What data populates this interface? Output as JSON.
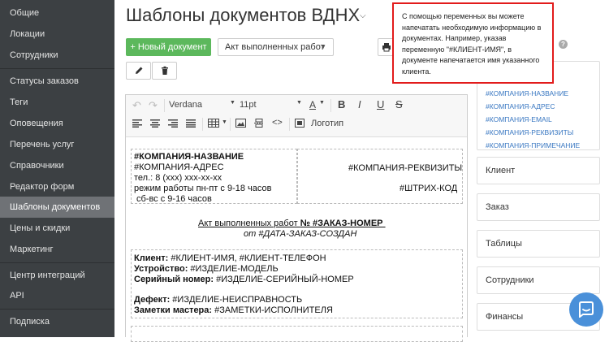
{
  "sidebar": {
    "items": [
      {
        "label": "Общие",
        "active": false
      },
      {
        "label": "Локации",
        "active": false
      },
      {
        "label": "Сотрудники",
        "active": false
      },
      {
        "label": "Статусы заказов",
        "active": false
      },
      {
        "label": "Теги",
        "active": false
      },
      {
        "label": "Оповещения",
        "active": false
      },
      {
        "label": "Перечень услуг",
        "active": false
      },
      {
        "label": "Справочники",
        "active": false
      },
      {
        "label": "Редактор форм",
        "active": false
      },
      {
        "label": "Шаблоны документов",
        "active": true
      },
      {
        "label": "Цены и скидки",
        "active": false
      },
      {
        "label": "Маркетинг",
        "active": false
      },
      {
        "label": "Центр интеграций",
        "active": false
      },
      {
        "label": "API",
        "active": false
      },
      {
        "label": "Подписка",
        "active": false
      }
    ]
  },
  "header": {
    "title": "Шаблоны документов ВДНХ",
    "new_doc_label": "+ Новый документ",
    "doc_select_value": "Акт выполненных работ"
  },
  "toolbar": {
    "font_family": "Verdana",
    "font_size": "11pt",
    "font_color_label": "A",
    "bold_label": "B",
    "italic_label": "I",
    "underline_label": "U",
    "strike_label": "S",
    "code_label": "<>",
    "logo_label": "Логотип"
  },
  "document": {
    "company_name": "#КОМПАНИЯ-НАЗВАНИЕ",
    "company_address": "#КОМПАНИЯ-АДРЕС",
    "phone": "тел.: 8 (xxx) xxx-xx-xx",
    "hours_weekday": "режим работы  пн-пт с 9-18 часов",
    "hours_weekend": "сб-вс с 9-16 часов",
    "company_requisites": "#КОМПАНИЯ-РЕКВИЗИТЫ",
    "barcode": "#ШТРИХ-КОД",
    "act_title_prefix": "Акт выполненных работ ",
    "act_title_number": "№ #ЗАКАЗ-НОМЕР",
    "act_date": "от #ДАТА-ЗАКАЗ-СОЗДАН",
    "client_label": "Клиент:",
    "client_value": " #КЛИЕНТ-ИМЯ, #КЛИЕНТ-ТЕЛЕФОН",
    "device_label": "Устройство:",
    "device_value": " #ИЗДЕЛИЕ-МОДЕЛЬ",
    "serial_label": "Серийный номер:",
    "serial_value": " #ИЗДЕЛИЕ-СЕРИЙНЫЙ-НОМЕР",
    "defect_label": "Дефект:",
    "defect_value": " #ИЗДЕЛИЕ-НЕИСПРАВНОСТЬ",
    "notes_label": "Заметки мастера:",
    "notes_value": " #ЗАМЕТКИ-ИСПОЛНИТЕЛЯ"
  },
  "variables": [
    "#КОМПАНИЯ-НАЗВАНИЕ",
    "#КОМПАНИЯ-АДРЕС",
    "#КОМПАНИЯ-EMAIL",
    "#КОМПАНИЯ-РЕКВИЗИТЫ",
    "#КОМПАНИЯ-ПРИМЕЧАНИЕ"
  ],
  "sections": [
    "Клиент",
    "Заказ",
    "Таблицы",
    "Сотрудники",
    "Финансы"
  ],
  "tooltip": {
    "text": "С помощью переменных вы можете напечатать необходимую информацию в документах. Например, указав переменную \"#КЛИЕНТ-ИМЯ\", в документе напечатается имя указанного клиента."
  },
  "colors": {
    "sidebar_bg": "#3c4043",
    "sidebar_active": "#6f7276",
    "primary_button": "#5cb85c",
    "link": "#3a78c2",
    "tooltip_border": "#e21b1b",
    "chat_button": "#4a90d9"
  },
  "icons": {
    "edit": "pencil-icon",
    "delete": "trash-icon",
    "print": "printer-icon",
    "help": "question-icon",
    "chat": "chat-icon"
  }
}
